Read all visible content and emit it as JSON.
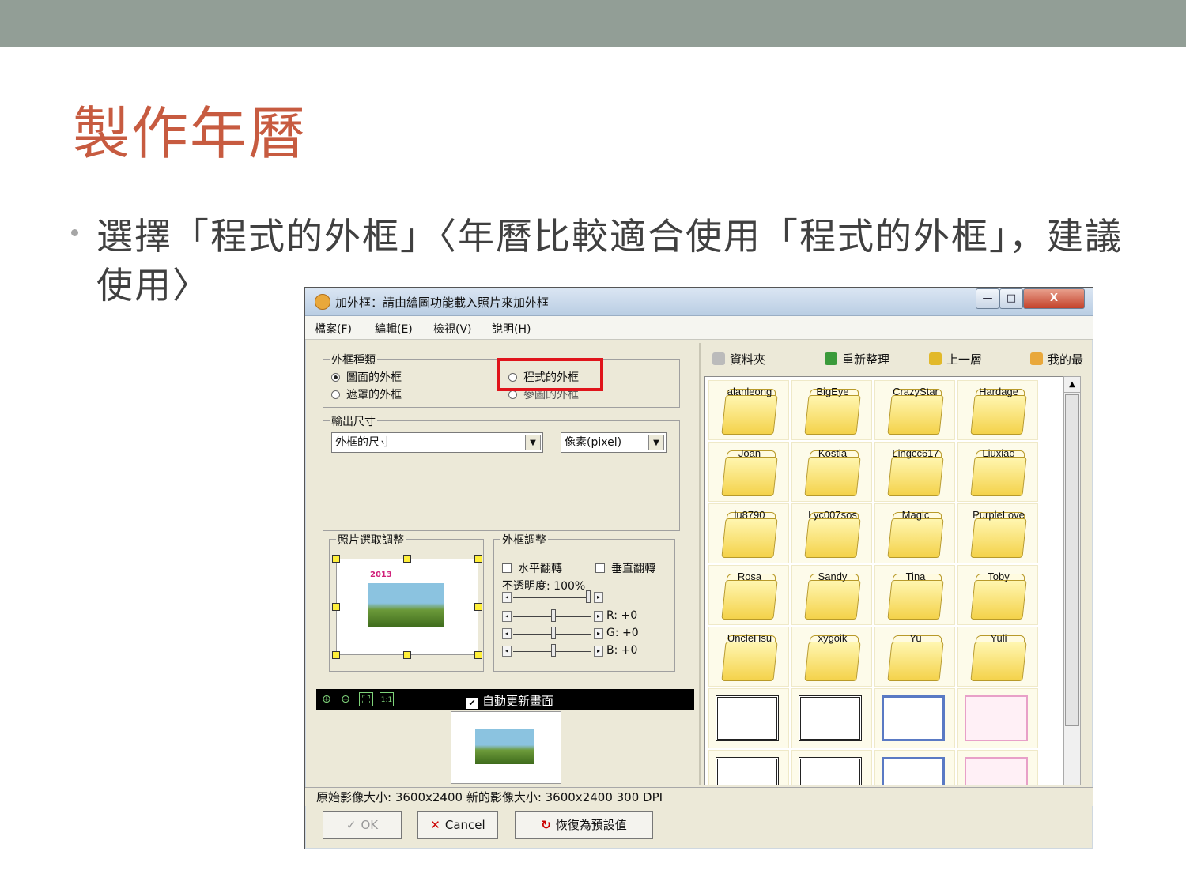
{
  "slide": {
    "title": "製作年曆",
    "bullet": "選擇「程式的外框」〈年曆比較適合使用「程式的外框」，建議使用〉"
  },
  "window": {
    "title": "加外框：請由繪圖功能載入照片來加外框",
    "buttons": {
      "minimize": "—",
      "maximize": "□",
      "close": "X"
    },
    "menu": [
      "檔案(F)",
      "編輯(E)",
      "檢視(V)",
      "說明(H)"
    ]
  },
  "frame_type": {
    "label": "外框種類",
    "options": [
      {
        "label": "圖面的外框",
        "selected": true
      },
      {
        "label": "遮罩的外框",
        "selected": false
      },
      {
        "label": "程式的外框",
        "selected": false
      },
      {
        "label": "參圖的外框",
        "selected": false
      }
    ]
  },
  "output_size": {
    "label": "輸出尺寸",
    "size_value": "外框的尺寸",
    "unit_value": "像素(pixel)"
  },
  "photo_adjust": {
    "label": "照片選取調整",
    "year": "2013"
  },
  "frame_adjust": {
    "label": "外框調整",
    "flip_h": "水平翻轉",
    "flip_v": "垂直翻轉",
    "opacity": "不透明度: 100%",
    "opacity_value": 1.0,
    "r": "R: +0",
    "g": "G: +0",
    "b": "B: +0"
  },
  "preview": {
    "auto_refresh": "自動更新畫面",
    "auto_refresh_checked": true,
    "zoom_icons": [
      "zoom-in-icon",
      "zoom-out-icon",
      "fit-icon",
      "actual-size-icon"
    ]
  },
  "browser": {
    "toolbar": [
      "資料夾",
      "重新整理",
      "上一層",
      "我的最"
    ],
    "folders": [
      "alanleong",
      "BigEye",
      "CrazyStar",
      "Hardage",
      "Joan",
      "Kostia",
      "Lingcc617",
      "Liuxiao",
      "lu8790",
      "Lyc007sos",
      "Magic",
      "PurpleLove",
      "Rosa",
      "Sandy",
      "Tina",
      "Toby",
      "UncleHsu",
      "xygoik",
      "Yu",
      "Yuli"
    ]
  },
  "status": "原始影像大小: 3600x2400    新的影像大小: 3600x2400 300 DPI",
  "footer_buttons": {
    "ok": "OK",
    "cancel": "Cancel",
    "reset": "恢復為預設值"
  },
  "colors": {
    "title_red": "#c75b40",
    "band_gray": "#929e96",
    "highlight_red": "#e0141b",
    "folder_yellow": "#f4d24a"
  }
}
